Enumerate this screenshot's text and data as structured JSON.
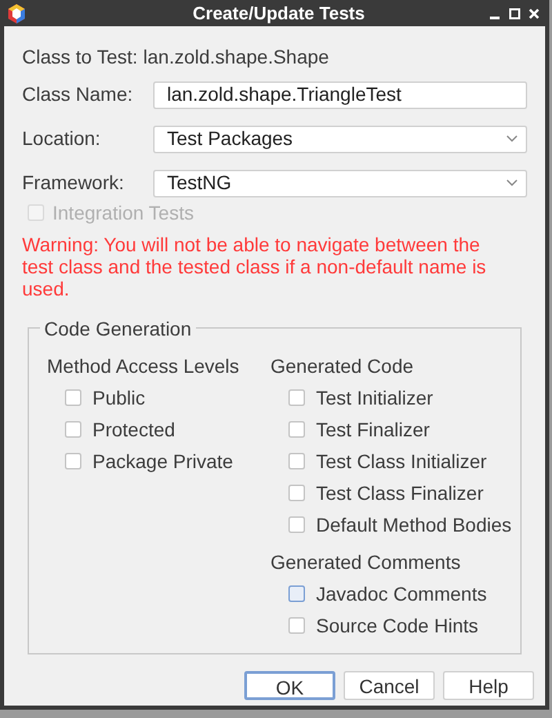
{
  "window": {
    "title": "Create/Update Tests"
  },
  "class_to_test": {
    "label": "Class to Test:",
    "value": "lan.zold.shape.Shape"
  },
  "fields": [
    {
      "label": "Class Name:",
      "kind": "text",
      "value": "lan.zold.shape.TriangleTest"
    },
    {
      "label": "Location:",
      "kind": "dropdown",
      "value": "Test Packages"
    },
    {
      "label": "Framework:",
      "kind": "dropdown",
      "value": "TestNG"
    }
  ],
  "integration_tests": {
    "label": "Integration Tests",
    "checked": false,
    "disabled": true
  },
  "warning": "Warning: You will not be able to navigate between the test class and the tested class if a non-default name is used.",
  "code_generation": {
    "title": "Code Generation",
    "columns": [
      {
        "groups": [
          {
            "title": "Method Access Levels",
            "options": [
              {
                "label": "Public",
                "checked": false,
                "focused": false
              },
              {
                "label": "Protected",
                "checked": false,
                "focused": false
              },
              {
                "label": "Package Private",
                "checked": false,
                "focused": false
              }
            ]
          }
        ]
      },
      {
        "groups": [
          {
            "title": "Generated Code",
            "options": [
              {
                "label": "Test Initializer",
                "checked": false,
                "focused": false
              },
              {
                "label": "Test Finalizer",
                "checked": false,
                "focused": false
              },
              {
                "label": "Test Class Initializer",
                "checked": false,
                "focused": false
              },
              {
                "label": "Test Class Finalizer",
                "checked": false,
                "focused": false
              },
              {
                "label": "Default Method Bodies",
                "checked": false,
                "focused": false
              }
            ]
          },
          {
            "title": "Generated Comments",
            "options": [
              {
                "label": "Javadoc Comments",
                "checked": false,
                "focused": true
              },
              {
                "label": "Source Code Hints",
                "checked": false,
                "focused": false
              }
            ]
          }
        ]
      }
    ]
  },
  "buttons": [
    {
      "label": "OK",
      "default": true
    },
    {
      "label": "Cancel",
      "default": false
    },
    {
      "label": "Help",
      "default": false
    }
  ]
}
